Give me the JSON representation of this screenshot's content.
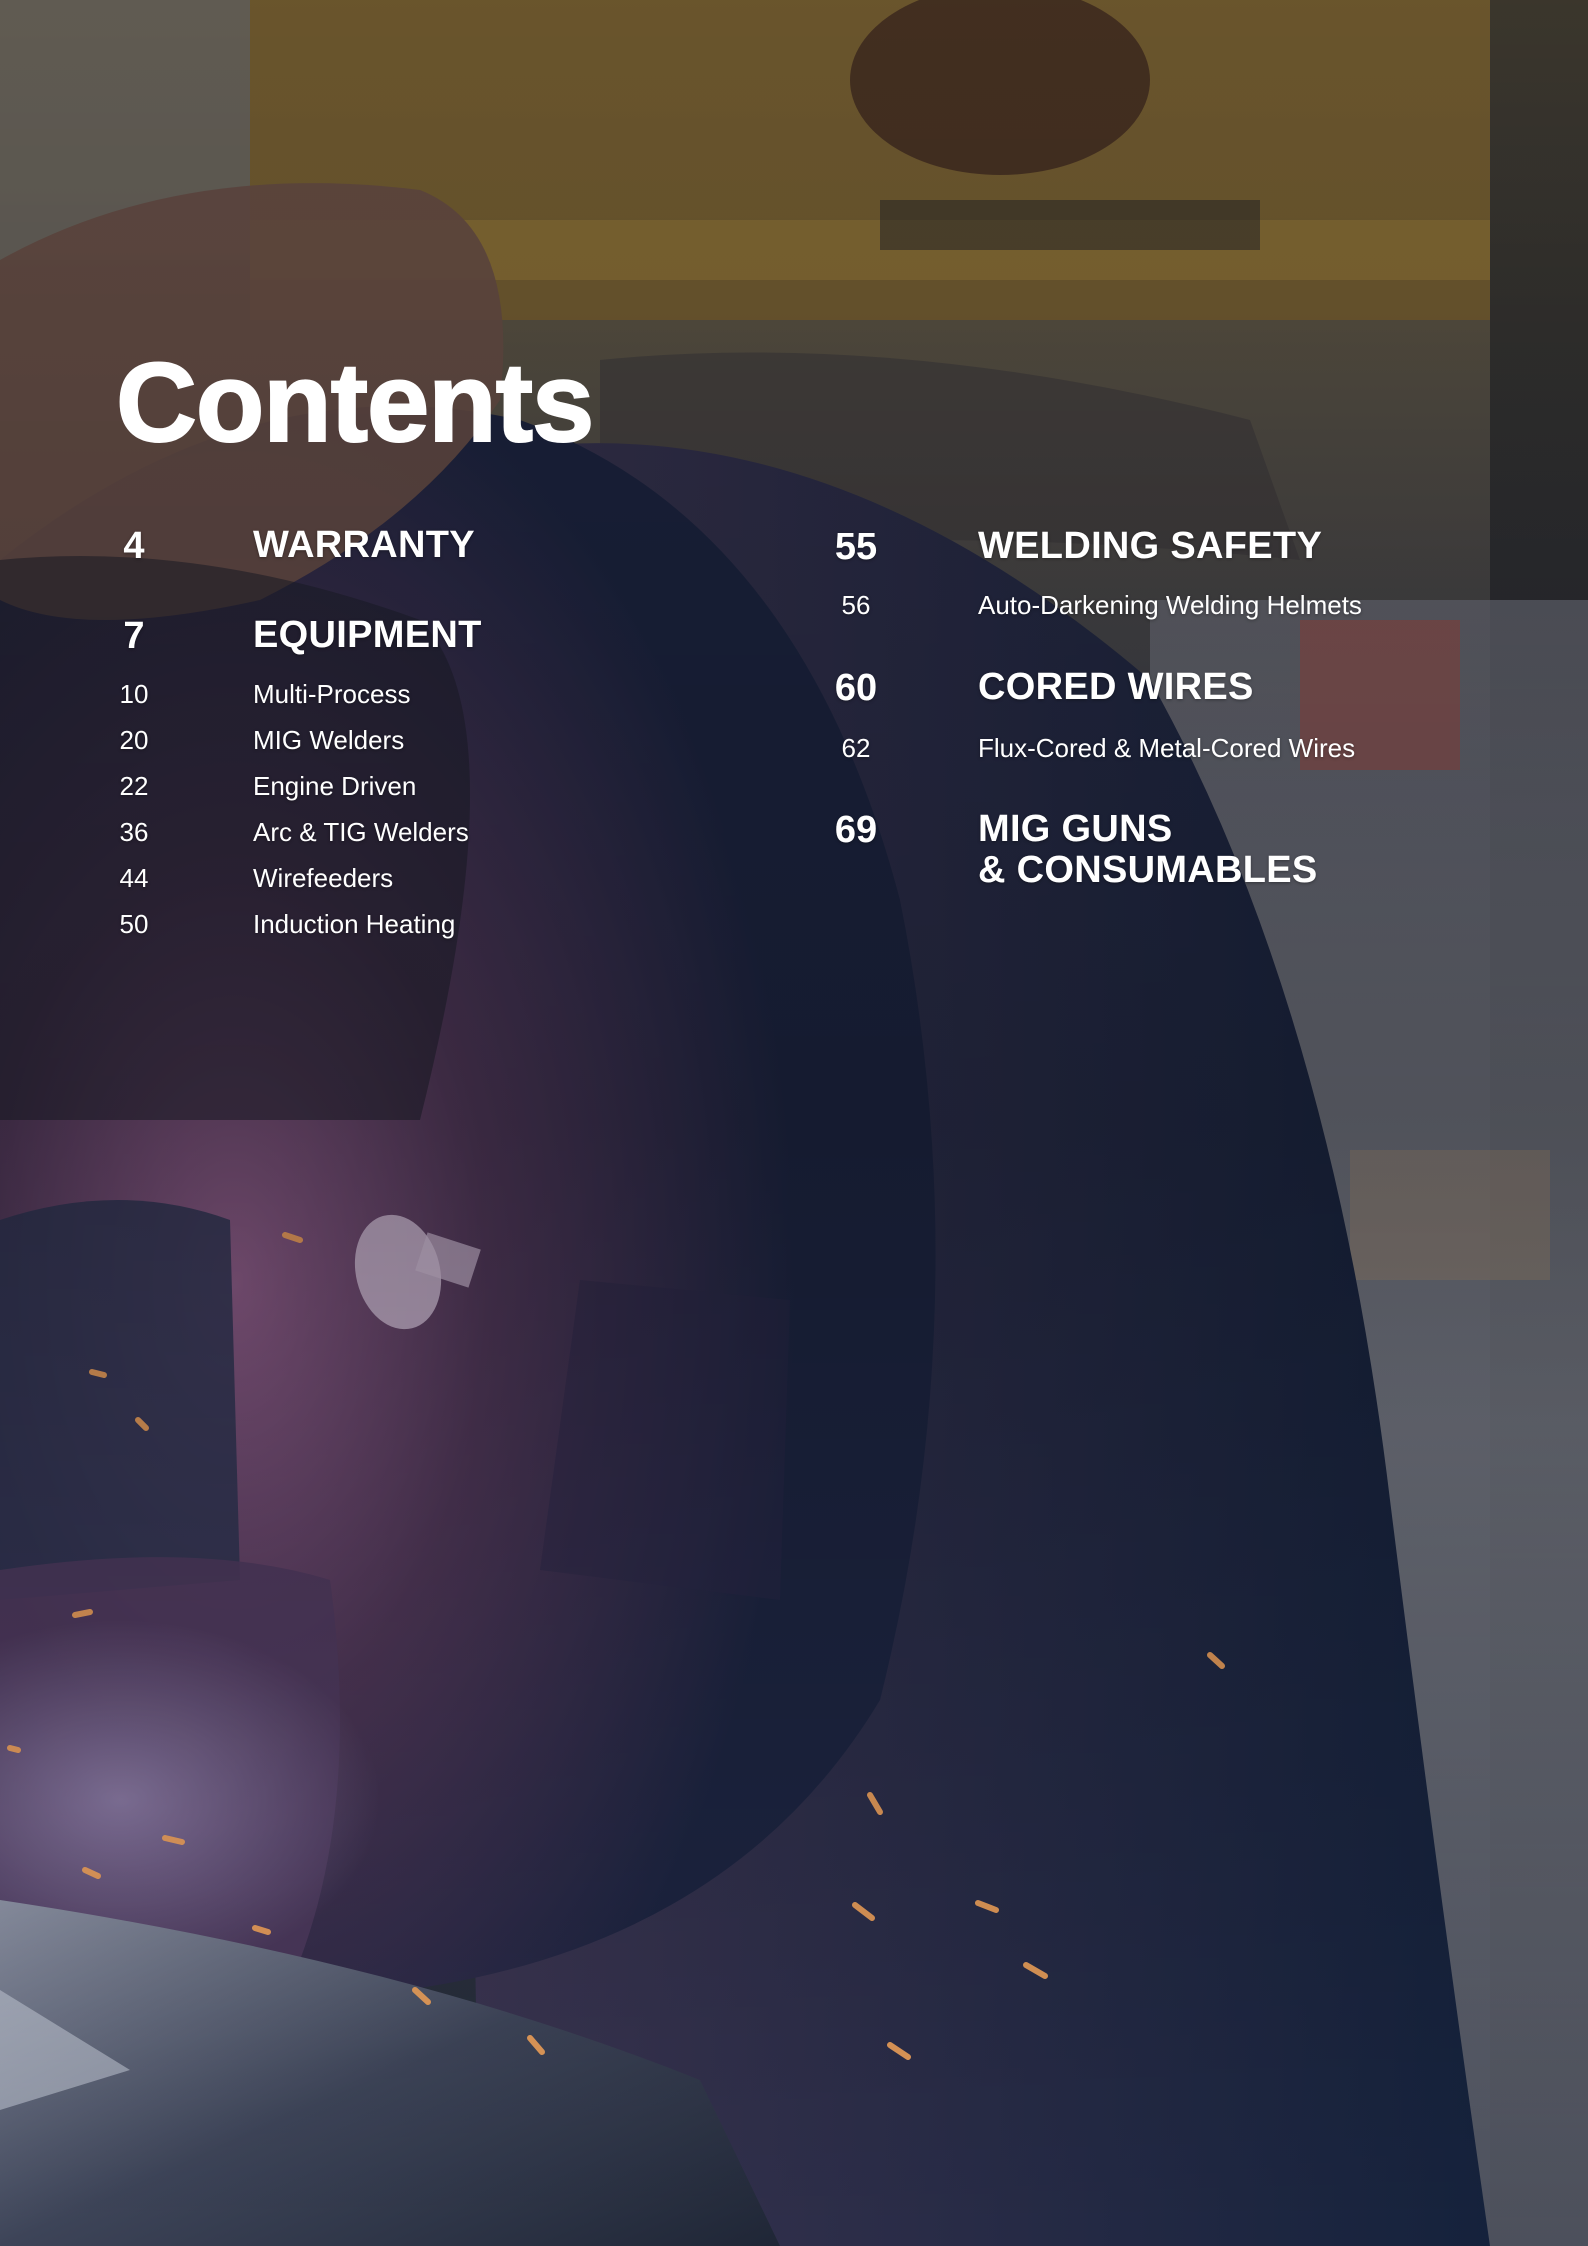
{
  "title": "Contents",
  "left_column": {
    "sections": [
      {
        "page": "4",
        "label": "WARRANTY",
        "items": []
      },
      {
        "page": "7",
        "label": "EQUIPMENT",
        "items": [
          {
            "page": "10",
            "label": "Multi-Process"
          },
          {
            "page": "20",
            "label": "MIG Welders"
          },
          {
            "page": "22",
            "label": "Engine Driven"
          },
          {
            "page": "36",
            "label": "Arc & TIG Welders"
          },
          {
            "page": "44",
            "label": "Wirefeeders"
          },
          {
            "page": "50",
            "label": "Induction Heating"
          }
        ]
      }
    ]
  },
  "right_column": {
    "sections": [
      {
        "page": "55",
        "label": "WELDING SAFETY",
        "items": [
          {
            "page": "56",
            "label": "Auto-Darkening Welding Helmets"
          }
        ]
      },
      {
        "page": "60",
        "label": "CORED WIRES",
        "items": [
          {
            "page": "62",
            "label": "Flux-Cored & Metal-Cored Wires"
          }
        ]
      },
      {
        "page": "69",
        "label_line1": "MIG GUNS",
        "label_line2": "& CONSUMABLES",
        "items": []
      }
    ]
  },
  "colors": {
    "text": "#ffffff",
    "background_dark": "#1b2130",
    "jacket_purple": "#5a3a5c",
    "jacket_navy": "#1e2a44",
    "machine_yellow": "#8a6a2c",
    "spark_orange": "#f2a35a"
  },
  "images": {
    "background": "photo of welder in Miller jacket working with sparks"
  }
}
